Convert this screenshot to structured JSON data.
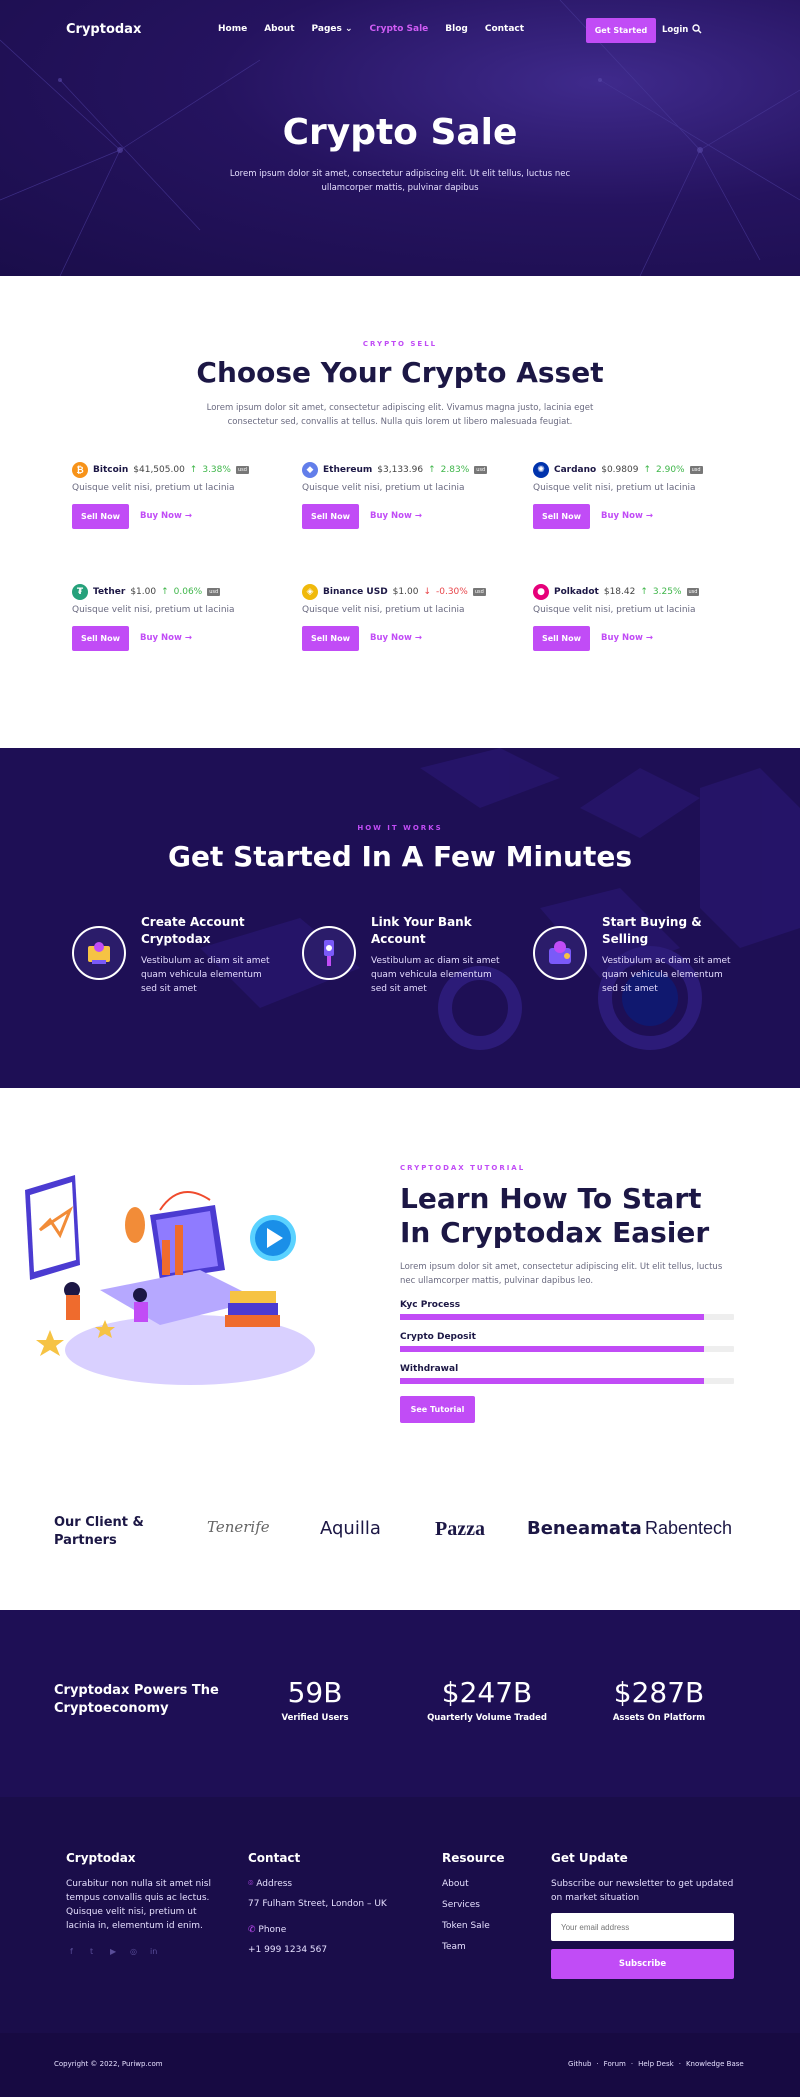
{
  "nav": {
    "logo": "Cryptodax",
    "items": [
      "Home",
      "About",
      "Pages",
      "Crypto Sale",
      "Blog",
      "Contact"
    ],
    "cta": "Get Started",
    "login": "Login"
  },
  "hero": {
    "title": "Crypto Sale",
    "subtitle": "Lorem ipsum dolor sit amet, consectetur adipiscing elit. Ut elit tellus, luctus nec ullamcorper mattis, pulvinar dapibus"
  },
  "assets": {
    "eyebrow": "CRYPTO SELL",
    "title": "Choose Your Crypto Asset",
    "subtitle": "Lorem ipsum dolor sit amet, consectetur adipiscing elit. Vivamus magna justo, lacinia eget consectetur sed, convallis at tellus. Nulla quis lorem ut libero malesuada feugiat.",
    "coins": [
      {
        "name": "Bitcoin",
        "price": "$41,505.00",
        "change": "3.38%",
        "dir": "up",
        "icon": "bitcoin-icon",
        "color": "#f7931a",
        "glyph": "₿"
      },
      {
        "name": "Ethereum",
        "price": "$3,133.96",
        "change": "2.83%",
        "dir": "up",
        "icon": "ethereum-icon",
        "color": "#627eea",
        "glyph": "◆"
      },
      {
        "name": "Cardano",
        "price": "$0.9809",
        "change": "2.90%",
        "dir": "up",
        "icon": "cardano-icon",
        "color": "#0033ad",
        "glyph": "✺"
      },
      {
        "name": "Tether",
        "price": "$1.00",
        "change": "0.06%",
        "dir": "up",
        "icon": "tether-icon",
        "color": "#26a17b",
        "glyph": "₮"
      },
      {
        "name": "Binance USD",
        "price": "$1.00",
        "change": "-0.30%",
        "dir": "down",
        "icon": "binance-usd-icon",
        "color": "#f0b90b",
        "glyph": "◈"
      },
      {
        "name": "Polkadot",
        "price": "$18.42",
        "change": "3.25%",
        "dir": "up",
        "icon": "polkadot-icon",
        "color": "#e6007a",
        "glyph": "●"
      }
    ],
    "coin_desc": "Quisque velit nisi, pretium ut lacinia",
    "sell_label": "Sell Now",
    "buy_label": "Buy Now",
    "usd_badge": "usd"
  },
  "how": {
    "eyebrow": "HOW IT WORKS",
    "title": "Get Started In A Few Minutes",
    "steps": [
      {
        "title": "Create Account Cryptodax",
        "desc": "Vestibulum ac diam sit amet quam vehicula elementum sed sit amet"
      },
      {
        "title": "Link Your Bank Account",
        "desc": "Vestibulum ac diam sit amet quam vehicula elementum sed sit amet"
      },
      {
        "title": "Start Buying & Selling",
        "desc": "Vestibulum ac diam sit amet quam vehicula elementum sed sit amet"
      }
    ]
  },
  "tutorial": {
    "eyebrow": "CRYPTODAX TUTORIAL",
    "title": "Learn How To Start In Cryptodax Easier",
    "subtitle": "Lorem ipsum dolor sit amet, consectetur adipiscing elit. Ut elit tellus, luctus nec ullamcorper mattis, pulvinar dapibus leo.",
    "bars": [
      {
        "label": "Kyc Process",
        "value": 0.91
      },
      {
        "label": "Crypto Deposit",
        "value": 0.91
      },
      {
        "label": "Withdrawal",
        "value": 0.91
      }
    ],
    "cta": "See Tutorial"
  },
  "partners": {
    "title": "Our Client & Partners",
    "logos": [
      "Tenerife",
      "Aquilla",
      "Pazza",
      "Beneamata",
      "Rabentech"
    ]
  },
  "stats": {
    "title": "Cryptodax Powers The Cryptoeconomy",
    "items": [
      {
        "value": "59B",
        "label": "Verified Users"
      },
      {
        "value": "$247B",
        "label": "Quarterly Volume Traded"
      },
      {
        "value": "$287B",
        "label": "Assets On Platform"
      }
    ]
  },
  "footer": {
    "brand": "Cryptodax",
    "about": "Curabitur non nulla sit amet nisl tempus convallis quis ac lectus. Quisque velit nisi, pretium ut lacinia in, elementum id enim.",
    "contact_title": "Contact",
    "address_label": "Address",
    "address": "77 Fulham Street, London – UK",
    "phone_label": "Phone",
    "phone": "+1 999 1234 567",
    "resource_title": "Resource",
    "resources": [
      "About",
      "Services",
      "Token Sale",
      "Team"
    ],
    "update_title": "Get Update",
    "update_text": "Subscribe our newsletter to get updated on market situation",
    "email_placeholder": "Your email address",
    "subscribe": "Subscribe",
    "copyright": "Copyright © 2022, Puriwp.com",
    "links": [
      "Github",
      "Forum",
      "Help Desk",
      "Knowledge Base"
    ]
  },
  "colors": {
    "accent": "#c14cf6",
    "navy": "#1e0f55",
    "up": "#3fb64a",
    "down": "#e8454a"
  }
}
